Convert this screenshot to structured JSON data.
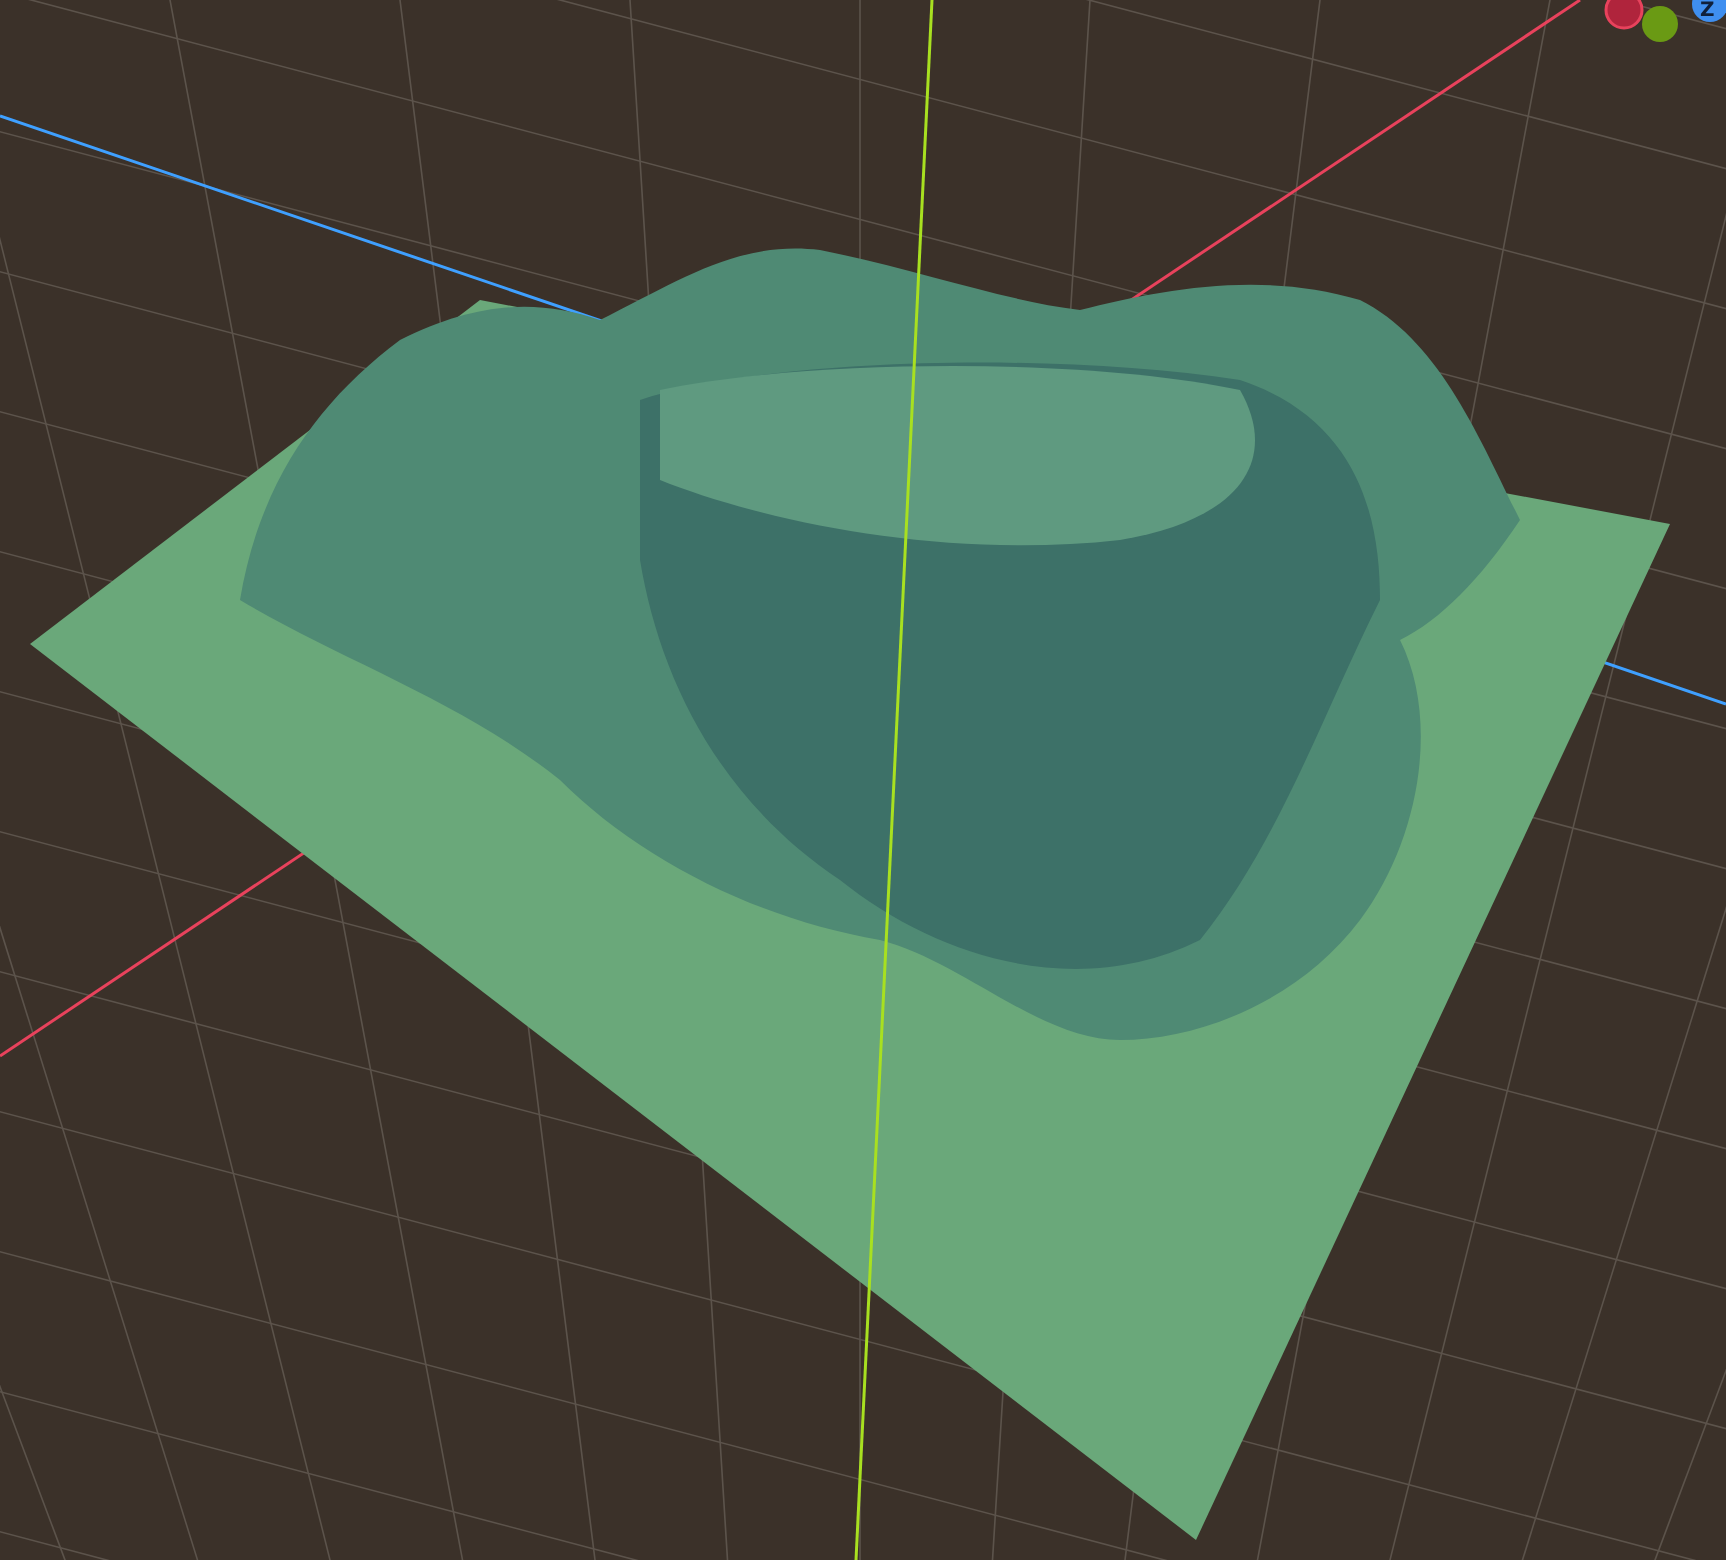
{
  "viewport": {
    "gizmo": {
      "z_label": "Z"
    }
  }
}
